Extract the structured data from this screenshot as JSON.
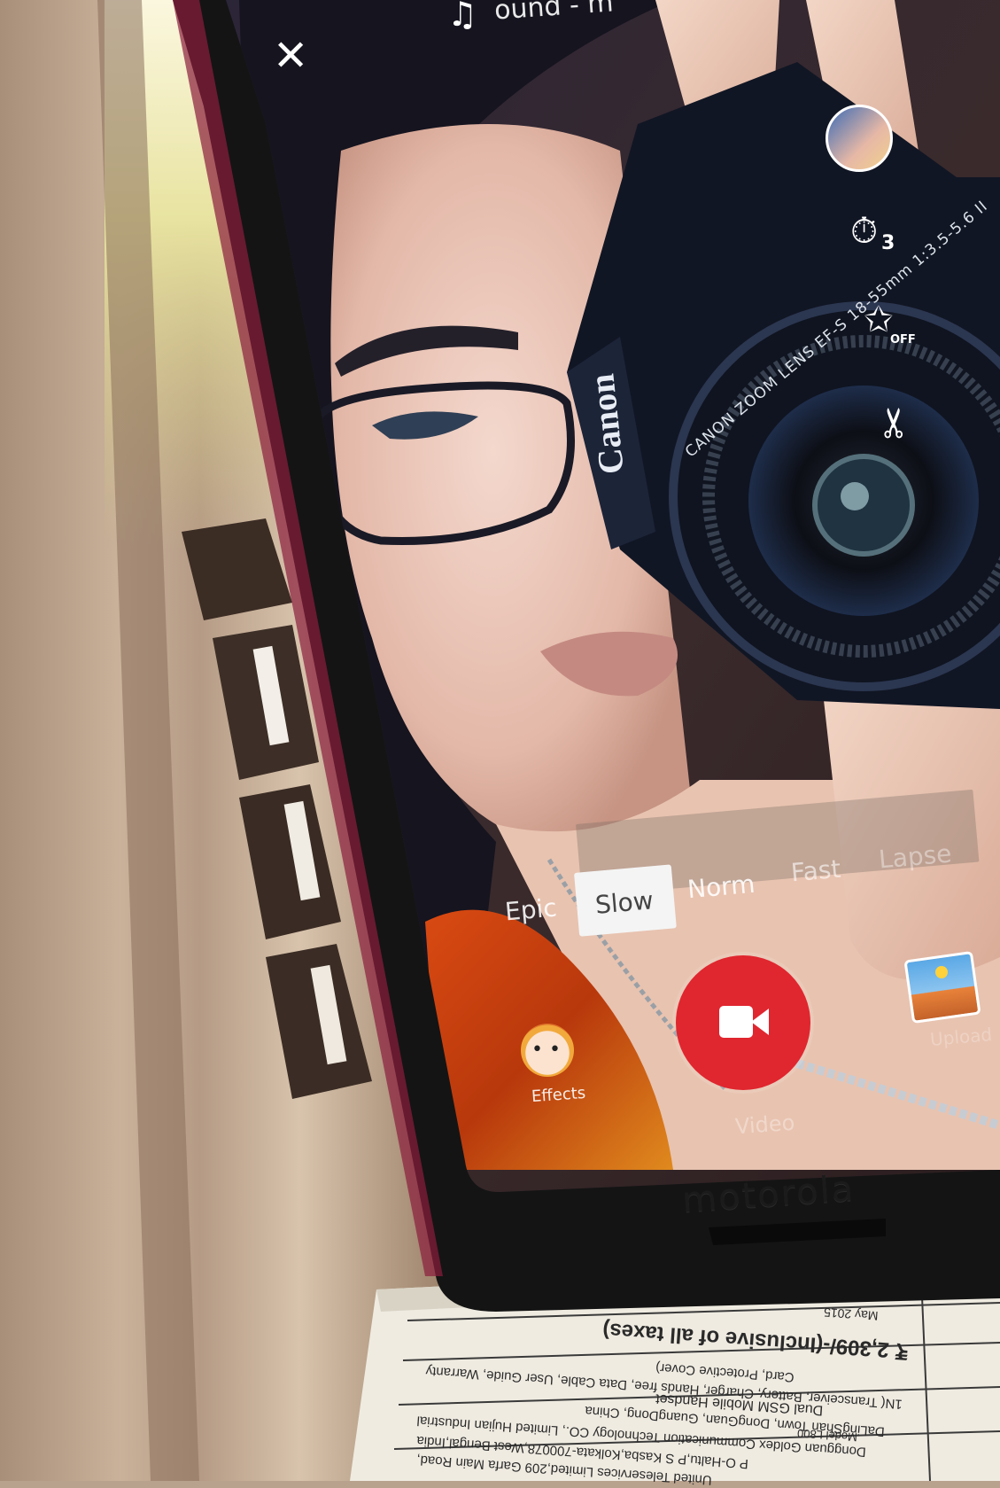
{
  "app": {
    "sound_label": "ound - m",
    "speed_options": [
      "Epic",
      "Slow",
      "Norm",
      "Fast",
      "Lapse"
    ],
    "selected_speed": "Slow",
    "effects_label": "Effects",
    "video_label": "Video",
    "upload_label": "Upload",
    "timer_badge": "3",
    "beauty_badge": "OFF"
  },
  "camera_lens": {
    "brand": "Canon",
    "ring_text": "CANON ZOOM LENS EF-S 18-55mm 1:3.5-5.6 II"
  },
  "phone": {
    "brand": "motorola"
  },
  "box_label": {
    "price": "₹ 2,309/-(Inclusive of all taxes)",
    "lines": [
      "May 2015",
      "Card, Protective Cover)",
      "1N( Transceiver, Battery, Charger, Hands free, Data Cable, User Guide, Warranty",
      "Dual GSM Mobile Handset",
      "DaLingShan Town, DongGuan, GuangDong, China",
      "Dongguan Goldex Communication Technology CO., Limited Hujian Industrial",
      "P O-Haltu,P S Kasba,Kolkata-700078,West Bengal,India",
      "Model L800",
      "United Teleservices Limited,209 Garfa Main Road,"
    ]
  },
  "colors": {
    "record_red": "#e0262f",
    "selected_pill": "#f4f4f4",
    "wall": "#b9a28d",
    "phone_body": "#141414"
  }
}
